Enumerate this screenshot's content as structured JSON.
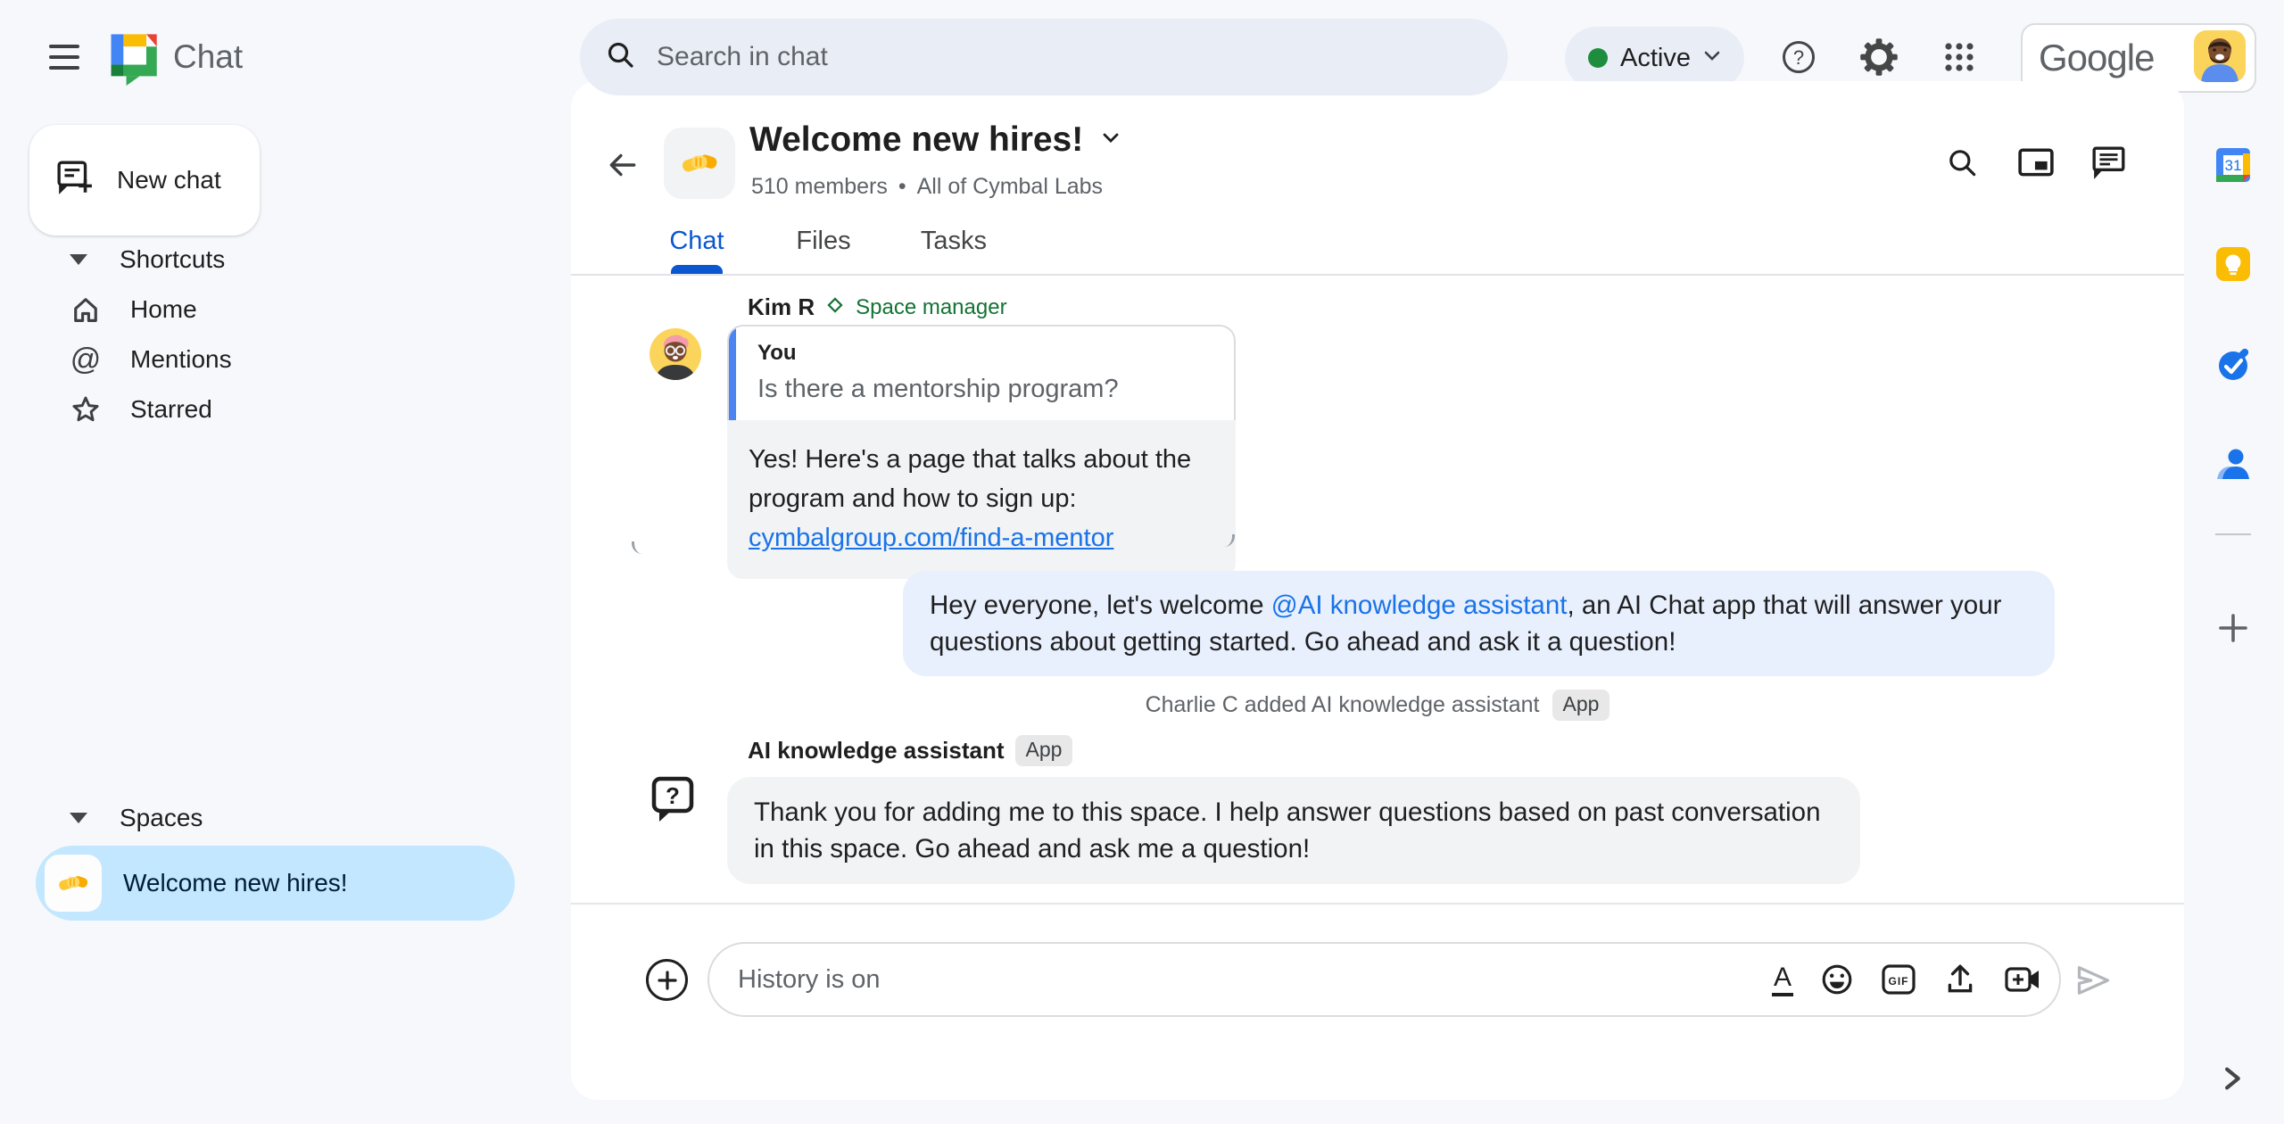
{
  "top_bar": {
    "app_name": "Chat",
    "search_placeholder": "Search in chat",
    "status_label": "Active",
    "google_wordmark": "Google"
  },
  "sidebar": {
    "new_chat_label": "New chat",
    "shortcuts_header": "Shortcuts",
    "shortcuts_items": [
      {
        "label": "Home",
        "icon": "home-icon"
      },
      {
        "label": "Mentions",
        "icon": "at-icon"
      },
      {
        "label": "Starred",
        "icon": "star-icon"
      }
    ],
    "spaces_header": "Spaces",
    "spaces_items": [
      {
        "label": "Welcome new hires!",
        "icon": "handshake-icon",
        "selected": true
      }
    ]
  },
  "space_header": {
    "title": "Welcome new hires!",
    "members": "510 members",
    "separator": "•",
    "org": "All of Cymbal Labs",
    "tabs": [
      {
        "label": "Chat",
        "active": true
      },
      {
        "label": "Files",
        "active": false
      },
      {
        "label": "Tasks",
        "active": false
      }
    ]
  },
  "messages": {
    "kim": {
      "name": "Kim R",
      "role": "Space manager",
      "quote_author": "You",
      "quote_text": "Is there a mentorship program?",
      "reply_text": "Yes! Here's a page that talks about the program and how to sign up:",
      "reply_link": "cymbalgroup.com/find-a-mentor"
    },
    "announcement": {
      "text_before": "Hey everyone, let's welcome ",
      "mention": "@AI knowledge assistant",
      "text_after": ", an AI Chat app that will answer your questions about getting started.  Go ahead and ask it a question!"
    },
    "system_event": {
      "text": "Charlie C added AI knowledge assistant",
      "badge": "App"
    },
    "assistant": {
      "name": "AI knowledge assistant",
      "badge": "App",
      "text": "Thank you for adding me to this space. I help answer questions based on past conversation in this space. Go ahead and ask me a question!"
    }
  },
  "compose": {
    "placeholder": "History is on",
    "gif_label": "GIF"
  },
  "colors": {
    "accent_blue": "#0b57d0",
    "link_blue": "#1a73e8",
    "selected_pill": "#c2e7ff",
    "own_bubble": "#e8f0fe",
    "other_bubble": "#f1f3f4",
    "manager_green": "#137333",
    "status_green": "#1e8e3e",
    "app_background": "#f6f8fc"
  },
  "icons": [
    "menu-icon",
    "chat-logo",
    "search-icon",
    "help-icon",
    "settings-gear-icon",
    "apps-grid-icon",
    "avatar",
    "new-chat-icon",
    "caret-down-icon",
    "home-icon",
    "at-icon",
    "star-icon",
    "handshake-icon",
    "back-arrow-icon",
    "chevron-down-icon",
    "pip-icon",
    "threads-icon",
    "diamond-icon",
    "question-bubble-icon",
    "plus-circle-icon",
    "format-icon",
    "emoji-icon",
    "gif-icon",
    "upload-icon",
    "video-plus-icon",
    "send-icon",
    "calendar-icon",
    "keep-icon",
    "tasks-icon",
    "contacts-icon",
    "plus-icon",
    "chevron-right-icon"
  ]
}
